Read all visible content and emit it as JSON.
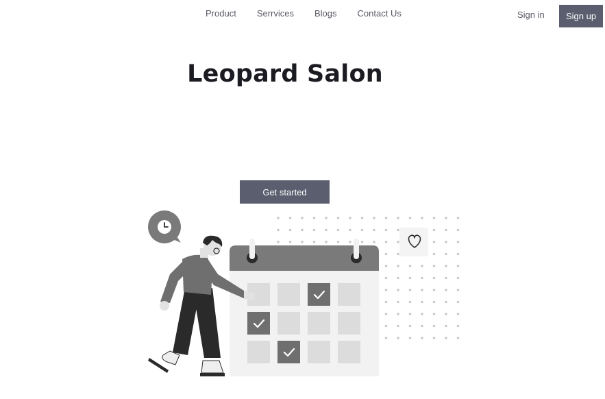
{
  "nav": {
    "items": [
      {
        "label": "Product"
      },
      {
        "label": "Serrvices"
      },
      {
        "label": "Blogs"
      },
      {
        "label": "Contact Us"
      }
    ]
  },
  "auth": {
    "signin_label": "Sign in",
    "signup_label": "Sign up"
  },
  "hero": {
    "title": "Leopard Salon",
    "cta_label": "Get started"
  },
  "illustration": {
    "icons": [
      "clock-icon",
      "heart-icon",
      "check-icon"
    ],
    "calendar_checked_cells": [
      [
        0,
        2
      ],
      [
        1,
        0
      ],
      [
        2,
        1
      ]
    ]
  },
  "colors": {
    "button_bg": "#5a5e6e",
    "button_text": "#ffffff",
    "nav_text": "#5a5a66",
    "title_text": "#1b1b22"
  }
}
